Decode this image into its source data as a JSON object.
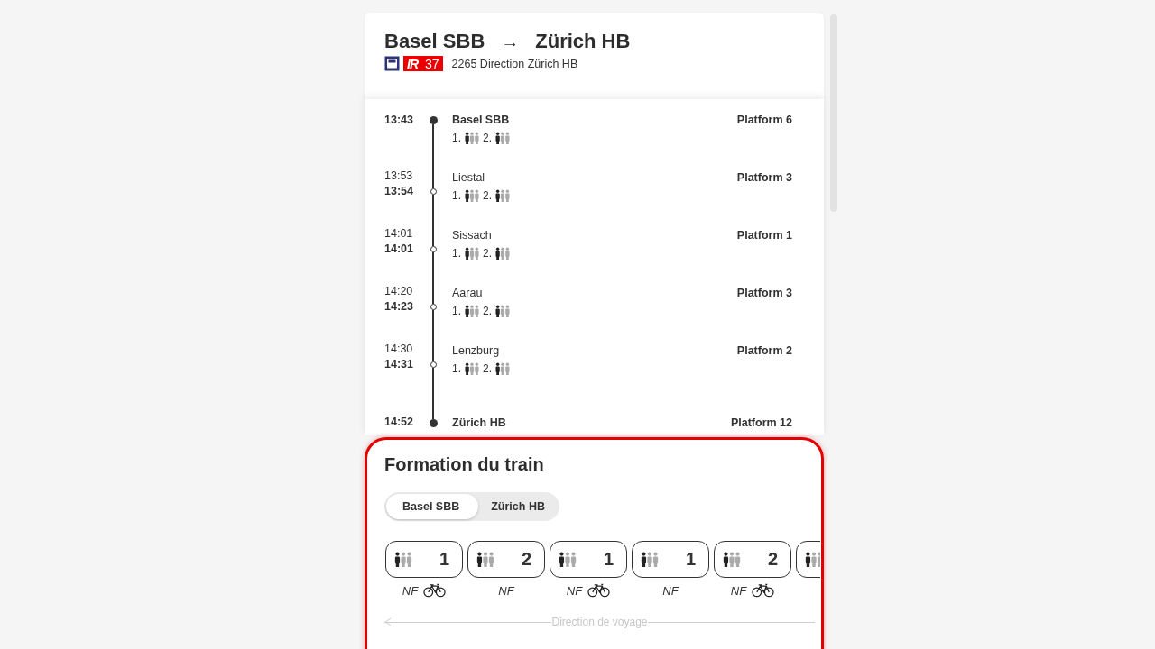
{
  "header": {
    "origin": "Basel SBB",
    "arrow": "→",
    "destination": "Zürich HB",
    "product": {
      "category": "IR",
      "line": "37"
    },
    "description": "2265 Direction Zürich HB"
  },
  "stops": [
    {
      "kind": "terminus",
      "time": "13:43",
      "name": "Basel SBB",
      "platform": "Platform 6",
      "classes": [
        {
          "label": "1.",
          "kind": "low"
        },
        {
          "label": "2.",
          "kind": "low"
        }
      ]
    },
    {
      "kind": "intermediate",
      "arrival": "13:53",
      "time": "13:54",
      "name": "Liestal",
      "platform": "Platform 3",
      "classes": [
        {
          "label": "1.",
          "kind": "low"
        },
        {
          "label": "2.",
          "kind": "low"
        }
      ]
    },
    {
      "kind": "intermediate",
      "arrival": "14:01",
      "time": "14:01",
      "name": "Sissach",
      "platform": "Platform 1",
      "classes": [
        {
          "label": "1.",
          "kind": "low"
        },
        {
          "label": "2.",
          "kind": "low"
        }
      ]
    },
    {
      "kind": "intermediate",
      "arrival": "14:20",
      "time": "14:23",
      "name": "Aarau",
      "platform": "Platform 3",
      "classes": [
        {
          "label": "1.",
          "kind": "low"
        },
        {
          "label": "2.",
          "kind": "low"
        }
      ]
    },
    {
      "kind": "intermediate",
      "arrival": "14:30",
      "time": "14:31",
      "name": "Lenzburg",
      "platform": "Platform 2",
      "classes": [
        {
          "label": "1.",
          "kind": "low"
        },
        {
          "label": "2.",
          "kind": "low"
        }
      ]
    },
    {
      "kind": "terminus",
      "time": "14:52",
      "name": "Zürich HB",
      "platform": "Platform 12"
    }
  ],
  "formation": {
    "title": "Formation du train",
    "segments": [
      {
        "label": "Basel SBB",
        "selected": true
      },
      {
        "label": "Zürich HB",
        "selected": false
      }
    ],
    "coaches": [
      {
        "class": "1",
        "kind": "low",
        "note": "NF",
        "bike": true
      },
      {
        "class": "2",
        "kind": "low",
        "note": "NF",
        "bike": false
      },
      {
        "class": "1",
        "kind": "low",
        "note": "NF",
        "bike": true
      },
      {
        "class": "1",
        "kind": "low",
        "note": "NF",
        "bike": false
      },
      {
        "class": "2",
        "kind": "low",
        "note": "NF",
        "bike": true
      },
      {
        "kind": "low"
      }
    ],
    "direction": "Direction de voyage"
  }
}
